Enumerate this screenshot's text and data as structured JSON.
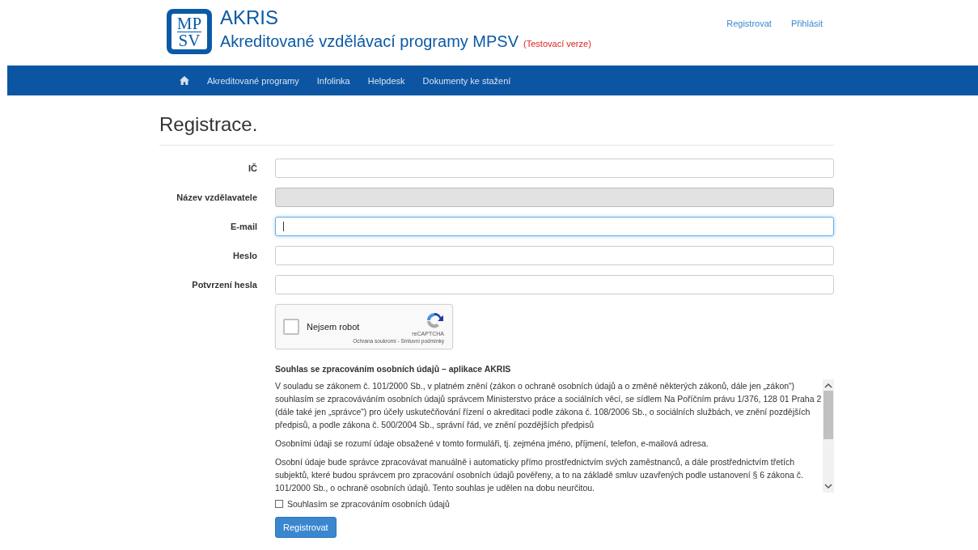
{
  "header": {
    "title": "AKRIS",
    "subtitle": "Akreditované vzdělávací programy MPSV",
    "badge": "(Testovací verze)",
    "logo": [
      "MP",
      "SV"
    ],
    "links": [
      "Registrovat",
      "Přihlásit"
    ]
  },
  "nav": {
    "items": [
      "Akreditované programy",
      "Infolinka",
      "Helpdesk",
      "Dokumenty ke stažení"
    ]
  },
  "page_title": "Registrace.",
  "fields": [
    {
      "label": "IČ",
      "disabled": false,
      "focused": false
    },
    {
      "label": "Název vzdělavatele",
      "disabled": true,
      "focused": false
    },
    {
      "label": "E-mail",
      "disabled": false,
      "focused": true
    },
    {
      "label": "Heslo",
      "disabled": false,
      "focused": false
    },
    {
      "label": "Potvrzení hesla",
      "disabled": false,
      "focused": false
    }
  ],
  "captcha": {
    "label": "Nejsem robot",
    "checked": false,
    "brand": "reCAPTCHA",
    "terms": "Ochrana soukromí - Smluvní podmínky"
  },
  "consent": {
    "title": "Souhlas se zpracováním osobních údajů – aplikace AKRIS",
    "paragraphs": [
      "V souladu se zákonem č. 101/2000 Sb., v platném znění (zákon o ochraně osobních údajů a o změně některých zákonů, dále jen „zákon“) souhlasím se zpracováváním osobních údajů správcem Ministerstvo práce a sociálních věcí, se sídlem Na Poříčním právu 1/376, 128 01 Praha 2 (dále také jen „správce“) pro účely uskutečňování řízení o akreditaci podle zákona č. 108/2006 Sb., o sociálních službách, ve znění pozdějších předpisů, a podle zákona č. 500/2004 Sb., správní řád, ve znění pozdějších předpisů",
      "Osobními údaji se rozumí údaje obsažené v tomto formuláři, tj. zejména jméno, příjmení, telefon, e-mailová adresa.",
      "Osobní údaje bude správce zpracovávat manuálně i automaticky přímo prostřednictvím svých zaměstnanců, a dále prostřednictvím třetích subjektů, které budou správcem pro zpracování osobních údajů pověřeny, a to na základě smluv uzavřených podle ustanovení § 6 zákona č. 101/2000 Sb., o ochraně osobních údajů. Tento souhlas je udělen na dobu neurčitou."
    ],
    "agree": {
      "label": "Souhlasím se zpracováním osobních údajů",
      "checked": false
    }
  },
  "submit": "Registrovat"
}
